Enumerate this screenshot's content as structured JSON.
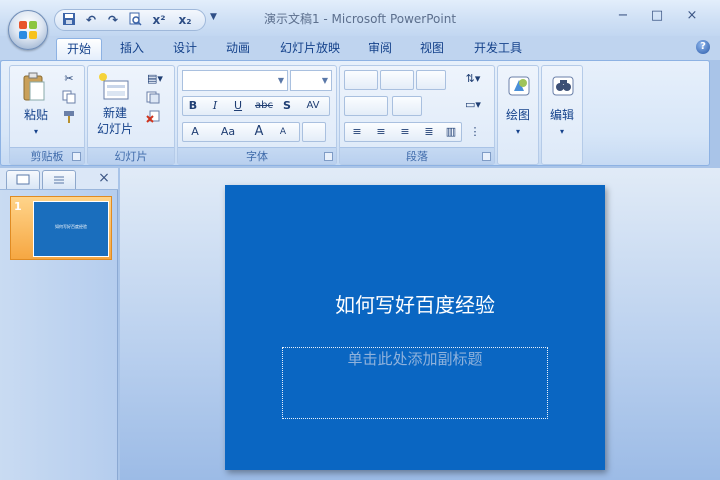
{
  "window": {
    "title": "演示文稿1 - Microsoft PowerPoint",
    "controls": {
      "minimize": "−",
      "maximize": "□",
      "close": "×"
    }
  },
  "quick_access": {
    "save_icon": "save-icon",
    "undo_icon": "undo-icon",
    "redo_icon": "redo-icon",
    "preview_icon": "print-preview-icon",
    "superscript": "x²",
    "subscript": "x₂"
  },
  "tabs": [
    "开始",
    "插入",
    "设计",
    "动画",
    "幻灯片放映",
    "审阅",
    "视图",
    "开发工具"
  ],
  "active_tab": "开始",
  "ribbon": {
    "clipboard": {
      "label": "剪贴板",
      "paste": "粘贴"
    },
    "slides": {
      "label": "幻灯片",
      "new_slide_line1": "新建",
      "new_slide_line2": "幻灯片"
    },
    "font": {
      "label": "字体",
      "bold": "B",
      "italic": "I",
      "underline": "U",
      "strike": "abc",
      "shadow": "S",
      "spacing": "AV",
      "color": "A",
      "case": "Aa",
      "grow": "A",
      "shrink": "A"
    },
    "paragraph": {
      "label": "段落"
    },
    "drawing": {
      "label": "绘图"
    },
    "editing": {
      "label": "编辑"
    }
  },
  "slide_panel": {
    "slide_number": "1"
  },
  "slide": {
    "title": "如何写好百度经验",
    "subtitle_placeholder": "单击此处添加副标题"
  },
  "colors": {
    "slide_bg": "#0a66c2",
    "accent": "#f6a742"
  }
}
